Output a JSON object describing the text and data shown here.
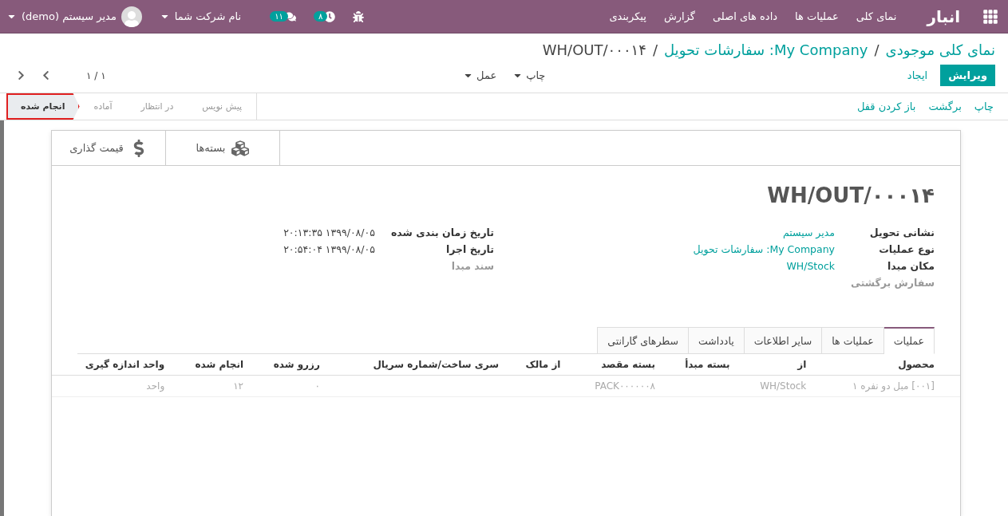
{
  "navbar": {
    "brand": "انبار",
    "menu": [
      "نمای کلی",
      "عملیات ها",
      "داده های اصلی",
      "گزارش",
      "پیکربندی"
    ],
    "activity_count": "۸",
    "message_count": "۱۱",
    "company": "نام شرکت شما",
    "user": "مدیر سیستم (demo)"
  },
  "breadcrumb": {
    "separator": "/",
    "items": [
      "نمای کلی موجودی",
      "My Company: سفارشات تحویل",
      "WH/OUT/۰۰۰۱۴"
    ]
  },
  "controls": {
    "primary": "ویرایش",
    "secondary": "ایجاد",
    "dropdowns": [
      "چاپ",
      "عمل"
    ],
    "pager": "۱ / ۱"
  },
  "statusbar": {
    "buttons": [
      "چاپ",
      "برگشت",
      "باز کردن قفل"
    ],
    "stages": [
      {
        "label": "پیش نویس",
        "selected": false
      },
      {
        "label": "در انتظار",
        "selected": false
      },
      {
        "label": "آماده",
        "selected": false
      },
      {
        "label": "انجام شده",
        "selected": true
      }
    ]
  },
  "button_box": [
    {
      "kind": "packages",
      "label": "بسته‌ها"
    },
    {
      "kind": "price",
      "label": "قیمت گذاری"
    }
  ],
  "title": "WH/OUT/۰۰۰۱۴",
  "right_fields": [
    {
      "label": "نشانی تحویل",
      "value": "مدیر سیستم",
      "muted": false
    },
    {
      "label": "نوع عملیات",
      "value": "My Company: سفارشات تحویل",
      "muted": false
    },
    {
      "label": "مکان مبدا",
      "value": "WH/Stock",
      "muted": false
    },
    {
      "label": "سفارش برگشتی",
      "muted": true
    }
  ],
  "left_fields": [
    {
      "label": "تاریخ زمان بندی شده",
      "value": "۱۳۹۹/۰۸/۰۵ ۲۰:۱۳:۳۵",
      "muted": false
    },
    {
      "label": "تاریخ اجرا",
      "value": "۱۳۹۹/۰۸/۰۵ ۲۰:۵۴:۰۴",
      "muted": false
    },
    {
      "label": "سند مبدا",
      "muted": true
    }
  ],
  "tabs": [
    {
      "label": "عملیات",
      "selected": true
    },
    {
      "label": "عملیات ها",
      "selected": false
    },
    {
      "label": "سایر اطلاعات",
      "selected": false
    },
    {
      "label": "یادداشت",
      "selected": false
    },
    {
      "label": "سطرهای گارانتی",
      "selected": false
    }
  ],
  "table": {
    "columns": [
      "محصول",
      "از",
      "بسته مبدأ",
      "بسته مقصد",
      "از مالک",
      "سری ساخت/شماره سریال",
      "رزرو شده",
      "انجام شده",
      "واحد اندازه گیری"
    ],
    "rows": [
      {
        "done": true,
        "cells": [
          "[۰۰۱] مبل دو نفره ۱",
          "WH/Stock",
          null,
          "PACK۰۰۰۰۰۰۸",
          null,
          null,
          "۰",
          "۱۲",
          "واحد"
        ]
      }
    ]
  }
}
